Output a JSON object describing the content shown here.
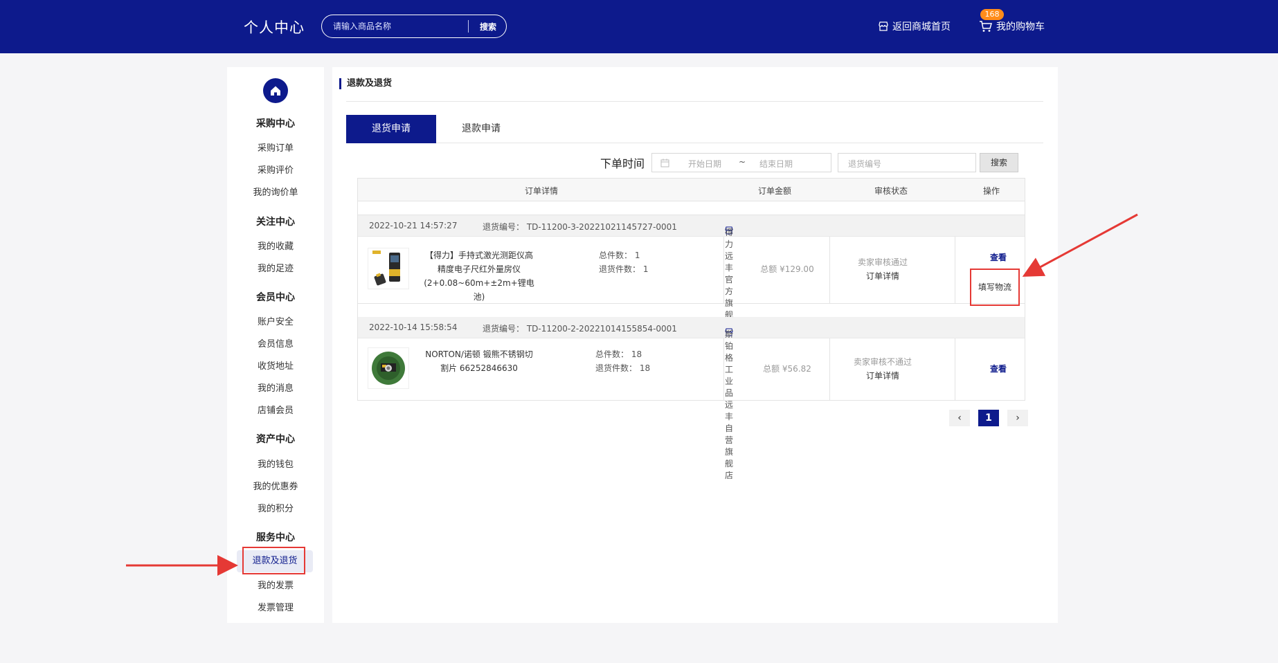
{
  "header": {
    "title": "个人中心",
    "search_placeholder": "请输入商品名称",
    "search_button": "搜索",
    "home_link": "返回商城首页",
    "cart_link": "我的购物车",
    "cart_count": "168"
  },
  "sidebar": {
    "groups": [
      {
        "title": "采购中心",
        "items": [
          "采购订单",
          "采购评价",
          "我的询价单"
        ]
      },
      {
        "title": "关注中心",
        "items": [
          "我的收藏",
          "我的足迹"
        ]
      },
      {
        "title": "会员中心",
        "items": [
          "账户安全",
          "会员信息",
          "收货地址",
          "我的消息",
          "店铺会员"
        ]
      },
      {
        "title": "资产中心",
        "items": [
          "我的钱包",
          "我的优惠券",
          "我的积分"
        ]
      },
      {
        "title": "服务中心",
        "items": [
          "退款及退货",
          "我的发票",
          "发票管理"
        ]
      }
    ]
  },
  "main": {
    "title": "退款及退货",
    "tabs": [
      {
        "label": "退货申请"
      },
      {
        "label": "退款申请"
      }
    ],
    "filter": {
      "label": "下单时间",
      "start_placeholder": "开始日期",
      "tilde": "~",
      "end_placeholder": "结束日期",
      "refund_no_placeholder": "退货编号",
      "search_button": "搜索"
    },
    "table_headers": [
      "订单详情",
      "订单金额",
      "审核状态",
      "操作"
    ],
    "orders": [
      {
        "time": "2022-10-21 14:57:27",
        "refund_no": "退货编号： TD-11200-3-20221021145727-0001",
        "shop": "得力远丰官方旗舰店",
        "product_lines": [
          "【得力】手持式激光测距仪高",
          "精度电子尺红外量房仪",
          "(2+0.08~60m+±2m+锂电池)"
        ],
        "total_count": "总件数： 1",
        "return_count": "退货件数： 1",
        "amount": "总额 ¥129.00",
        "status": "卖家审核通过",
        "detail": "订单详情",
        "view": "查看",
        "logistics": "填写物流"
      },
      {
        "time": "2022-10-14 15:58:54",
        "refund_no": "退货编号： TD-11200-2-20221014155854-0001",
        "shop": "斯铂格工业品远丰自营旗舰店",
        "product_lines": [
          "NORTON/诺顿 锻熊不锈钢切",
          "割片 66252846630"
        ],
        "total_count": "总件数： 18",
        "return_count": "退货件数： 18",
        "amount": "总额 ¥56.82",
        "status": "卖家审核不通过",
        "detail": "订单详情",
        "view": "查看"
      }
    ],
    "pagination": {
      "prev": "‹",
      "current": "1",
      "next": "›"
    }
  },
  "colors": {
    "brand": "#0d1a8c",
    "highlight": "#e53935",
    "badge": "#ff8c1a"
  }
}
